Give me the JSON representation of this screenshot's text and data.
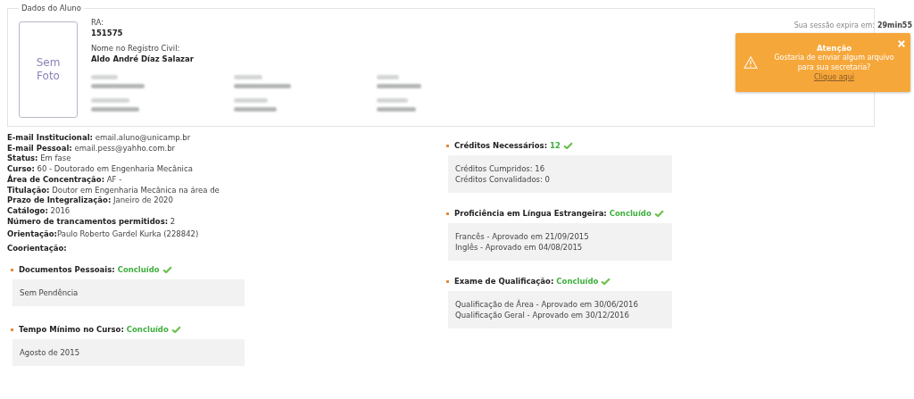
{
  "student": {
    "legend": "Dados do Aluno",
    "photo_text": "Sem Foto",
    "ra_label": "RA:",
    "ra": "151575",
    "name_label": "Nome no Registro Civil:",
    "name": "Aldo André Díaz Salazar"
  },
  "session": {
    "label": "Sua sessão expira em:",
    "time": "29min55"
  },
  "toast": {
    "title": "Atenção",
    "message": "Gostaria de enviar algum arquivo para sua secretaria?",
    "link": "Clique aqui"
  },
  "info": [
    {
      "label": "E-mail Institucional:",
      "value": "email.aluno@unicamp.br"
    },
    {
      "label": "E-mail Pessoal:",
      "value": "email.pess@yahho.com.br"
    },
    {
      "label": "Status:",
      "value": "Em fase"
    },
    {
      "label": "Curso:",
      "value": "60 - Doutorado em Engenharia Mecânica"
    },
    {
      "label": "Área de Concentração:",
      "value": "AF -"
    },
    {
      "label": "Titulação:",
      "value": "Doutor em Engenharia Mecânica na área de"
    },
    {
      "label": "Prazo de Integralização:",
      "value": "Janeiro de 2020"
    },
    {
      "label": "Catálogo:",
      "value": "2016"
    },
    {
      "label": "Número de trancamentos permitidos:",
      "value": "2"
    }
  ],
  "advisors": [
    {
      "label": "Orientação:",
      "value": "Paulo Roberto Gardel Kurka (228842)"
    },
    {
      "label": "Coorientação:"
    }
  ],
  "sections_left": [
    {
      "title": "Documentos Pessoais:",
      "status": "Concluído",
      "lines": [
        "Sem Pendência"
      ]
    },
    {
      "title": "Tempo Mínimo no Curso:",
      "status": "Concluído",
      "lines": [
        "Agosto de 2015"
      ]
    }
  ],
  "sections_right": [
    {
      "title": "Créditos Necessários:",
      "status": "12",
      "lines": [
        "Créditos Cumpridos: 16",
        "Créditos Convalidados: 0"
      ]
    },
    {
      "title": "Proficiência em Língua Estrangeira:",
      "status": "Concluído",
      "lines": [
        "Francês - Aprovado em 21/09/2015",
        "Inglês - Aprovado em 04/08/2015"
      ]
    },
    {
      "title": "Exame de Qualificação:",
      "status": "Concluído",
      "lines": [
        "Qualificação de Área - Aprovado em 30/06/2016",
        "Qualificação Geral - Aprovado em 30/12/2016"
      ]
    }
  ]
}
